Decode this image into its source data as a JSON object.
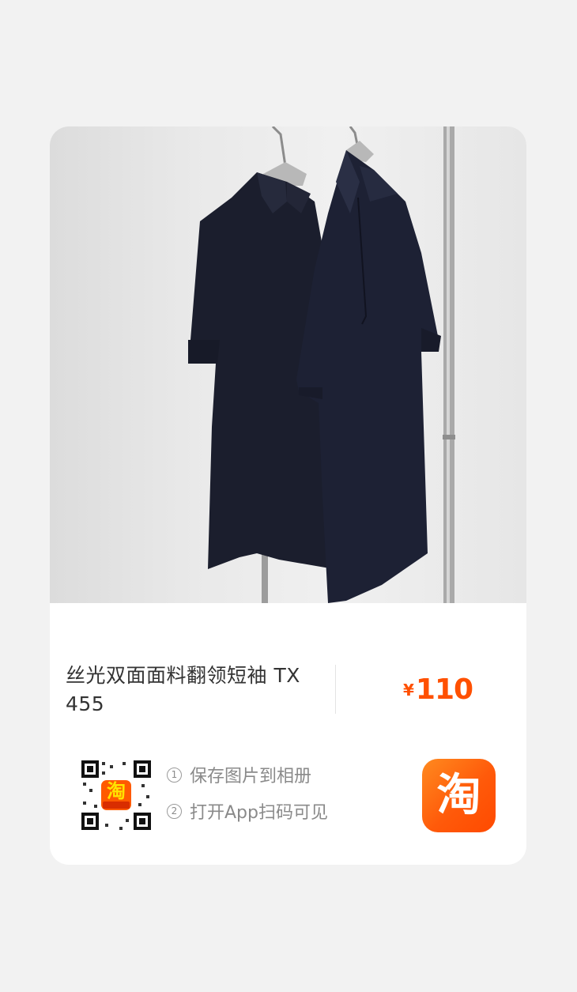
{
  "product": {
    "title": "丝光双面面料翻领短袖 TX 455",
    "currency_symbol": "¥",
    "price": "110"
  },
  "share": {
    "step1_num": "1",
    "step1": "保存图片到相册",
    "step2_num": "2",
    "step2": "打开App扫码可见",
    "qr_center_logo": "淘"
  },
  "app_icon": {
    "glyph": "淘",
    "color": "#ff5000"
  },
  "colors": {
    "accent": "#ff5000",
    "title_text": "#333333",
    "muted_text": "#8a8a8a"
  }
}
